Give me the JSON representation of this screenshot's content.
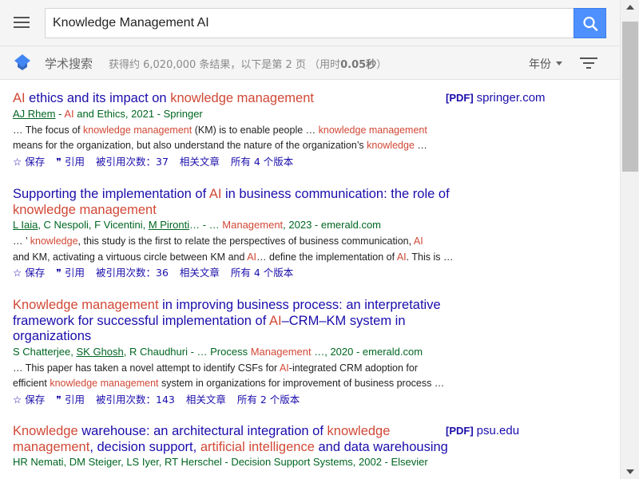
{
  "search": {
    "query": "Knowledge Management AI"
  },
  "subheader": {
    "brand": "学术搜索",
    "stats_prefix": "获得约 6,020,000 条结果，以下是第 2 页 （用时",
    "stats_time": "0.05秒",
    "stats_suffix": "）",
    "year_filter": "年份"
  },
  "actions": {
    "save": "保存",
    "cite": "引用",
    "related": "相关文章"
  },
  "results": [
    {
      "title_parts": [
        [
          "AI",
          true
        ],
        [
          " ethics and its impact on ",
          false
        ],
        [
          "knowledge management",
          true
        ]
      ],
      "side_tag": "[PDF]",
      "side_source": "springer.com",
      "meta_parts": [
        [
          "AJ Rhem",
          "author"
        ],
        [
          " - ",
          ""
        ],
        [
          "AI",
          "hl"
        ],
        [
          " and Ethics, 2021 - Springer",
          ""
        ]
      ],
      "snippet_lines": [
        [
          [
            "… The focus of ",
            false
          ],
          [
            "knowledge management",
            true
          ],
          [
            " (KM) is to enable people … ",
            false
          ],
          [
            "knowledge management",
            true
          ]
        ],
        [
          [
            "means for the organization, but also understand the nature of the organization’s ",
            false
          ],
          [
            "knowledge",
            true
          ],
          [
            " …",
            false
          ]
        ]
      ],
      "cited_by": "被引用次数：37",
      "versions": "所有 4 个版本"
    },
    {
      "title_parts": [
        [
          "Supporting the implementation of ",
          false
        ],
        [
          "AI",
          true
        ],
        [
          " in business communication: the role of ",
          false
        ],
        [
          "knowledge management",
          true
        ]
      ],
      "side_tag": "",
      "side_source": "",
      "meta_parts": [
        [
          "L Iaia",
          "author"
        ],
        [
          ", C Nespoli, F Vicentini, ",
          ""
        ],
        [
          "M Pironti",
          "author"
        ],
        [
          "… - … ",
          ""
        ],
        [
          "Management",
          "hl"
        ],
        [
          ", 2023 - emerald.com",
          ""
        ]
      ],
      "snippet_lines": [
        [
          [
            "… ’ ",
            false
          ],
          [
            "knowledge",
            true
          ],
          [
            ", this study is the first to relate the perspectives of business communication, ",
            false
          ],
          [
            "AI",
            true
          ]
        ],
        [
          [
            "and KM, activating a virtuous circle between KM and ",
            false
          ],
          [
            "AI",
            true
          ],
          [
            "… define the implementation of ",
            false
          ],
          [
            "AI",
            true
          ],
          [
            ". This is …",
            false
          ]
        ]
      ],
      "cited_by": "被引用次数：36",
      "versions": "所有 4 个版本"
    },
    {
      "title_parts": [
        [
          "Knowledge management",
          true
        ],
        [
          " in improving business process: an interpretative framework for successful implementation of ",
          false
        ],
        [
          "AI",
          true
        ],
        [
          "–CRM–KM system in organizations",
          false
        ]
      ],
      "side_tag": "",
      "side_source": "",
      "meta_parts": [
        [
          "S Chatterjee, ",
          ""
        ],
        [
          "SK Ghosh",
          "author"
        ],
        [
          ", R Chaudhuri - … Process ",
          ""
        ],
        [
          "Management",
          "hl"
        ],
        [
          " …, 2020 - emerald.com",
          ""
        ]
      ],
      "snippet_lines": [
        [
          [
            "… This paper has taken a novel attempt to identify CSFs for ",
            false
          ],
          [
            "AI",
            true
          ],
          [
            "-integrated CRM adoption for",
            false
          ]
        ],
        [
          [
            "efficient ",
            false
          ],
          [
            "knowledge management",
            true
          ],
          [
            " system in organizations for improvement of business process …",
            false
          ]
        ]
      ],
      "cited_by": "被引用次数：143",
      "versions": "所有 2 个版本"
    },
    {
      "title_parts": [
        [
          "Knowledge",
          true
        ],
        [
          " warehouse: an architectural integration of ",
          false
        ],
        [
          "knowledge management",
          true
        ],
        [
          ", decision support, ",
          false
        ],
        [
          "artificial intelligence",
          true
        ],
        [
          " and data warehousing",
          false
        ]
      ],
      "side_tag": "[PDF]",
      "side_source": "psu.edu",
      "meta_parts": [
        [
          "HR Nemati, DM Steiger, LS Iyer, RT Herschel - Decision Support Systems, 2002 - Elsevier",
          ""
        ]
      ],
      "snippet_lines": [],
      "cited_by": "",
      "versions": ""
    }
  ]
}
